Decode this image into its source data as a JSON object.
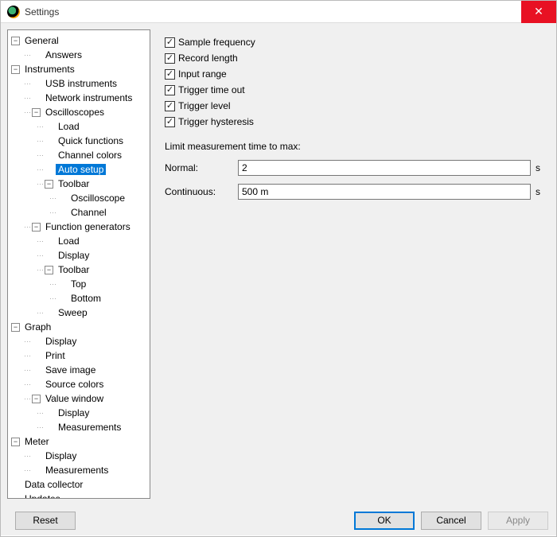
{
  "title": "Settings",
  "tree": [
    {
      "lbl": "General",
      "depth": 0,
      "tog": "-"
    },
    {
      "lbl": "Answers",
      "depth": 1,
      "tog": ""
    },
    {
      "lbl": "Instruments",
      "depth": 0,
      "tog": "-"
    },
    {
      "lbl": "USB instruments",
      "depth": 1,
      "tog": ""
    },
    {
      "lbl": "Network instruments",
      "depth": 1,
      "tog": ""
    },
    {
      "lbl": "Oscilloscopes",
      "depth": 1,
      "tog": "-"
    },
    {
      "lbl": "Load",
      "depth": 2,
      "tog": ""
    },
    {
      "lbl": "Quick functions",
      "depth": 2,
      "tog": ""
    },
    {
      "lbl": "Channel colors",
      "depth": 2,
      "tog": ""
    },
    {
      "lbl": "Auto setup",
      "depth": 2,
      "tog": "",
      "selected": true
    },
    {
      "lbl": "Toolbar",
      "depth": 2,
      "tog": "-"
    },
    {
      "lbl": "Oscilloscope",
      "depth": 3,
      "tog": ""
    },
    {
      "lbl": "Channel",
      "depth": 3,
      "tog": ""
    },
    {
      "lbl": "Function generators",
      "depth": 1,
      "tog": "-"
    },
    {
      "lbl": "Load",
      "depth": 2,
      "tog": ""
    },
    {
      "lbl": "Display",
      "depth": 2,
      "tog": ""
    },
    {
      "lbl": "Toolbar",
      "depth": 2,
      "tog": "-"
    },
    {
      "lbl": "Top",
      "depth": 3,
      "tog": ""
    },
    {
      "lbl": "Bottom",
      "depth": 3,
      "tog": ""
    },
    {
      "lbl": "Sweep",
      "depth": 2,
      "tog": ""
    },
    {
      "lbl": "Graph",
      "depth": 0,
      "tog": "-"
    },
    {
      "lbl": "Display",
      "depth": 1,
      "tog": ""
    },
    {
      "lbl": "Print",
      "depth": 1,
      "tog": ""
    },
    {
      "lbl": "Save image",
      "depth": 1,
      "tog": ""
    },
    {
      "lbl": "Source colors",
      "depth": 1,
      "tog": ""
    },
    {
      "lbl": "Value window",
      "depth": 1,
      "tog": "-"
    },
    {
      "lbl": "Display",
      "depth": 2,
      "tog": ""
    },
    {
      "lbl": "Measurements",
      "depth": 2,
      "tog": ""
    },
    {
      "lbl": "Meter",
      "depth": 0,
      "tog": "-"
    },
    {
      "lbl": "Display",
      "depth": 1,
      "tog": ""
    },
    {
      "lbl": "Measurements",
      "depth": 1,
      "tog": ""
    },
    {
      "lbl": "Data collector",
      "depth": 0,
      "tog": ""
    },
    {
      "lbl": "Updates",
      "depth": 0,
      "tog": ""
    }
  ],
  "checks": [
    {
      "label": "Sample frequency",
      "checked": true
    },
    {
      "label": "Record length",
      "checked": true
    },
    {
      "label": "Input range",
      "checked": true
    },
    {
      "label": "Trigger time out",
      "checked": true
    },
    {
      "label": "Trigger level",
      "checked": true
    },
    {
      "label": "Trigger hysteresis",
      "checked": true
    }
  ],
  "limit_label": "Limit measurement time to max:",
  "form": {
    "normal_label": "Normal:",
    "normal_value": "2",
    "normal_unit": "s",
    "continuous_label": "Continuous:",
    "continuous_value": "500 m",
    "continuous_unit": "s"
  },
  "buttons": {
    "reset": "Reset",
    "ok": "OK",
    "cancel": "Cancel",
    "apply": "Apply"
  }
}
